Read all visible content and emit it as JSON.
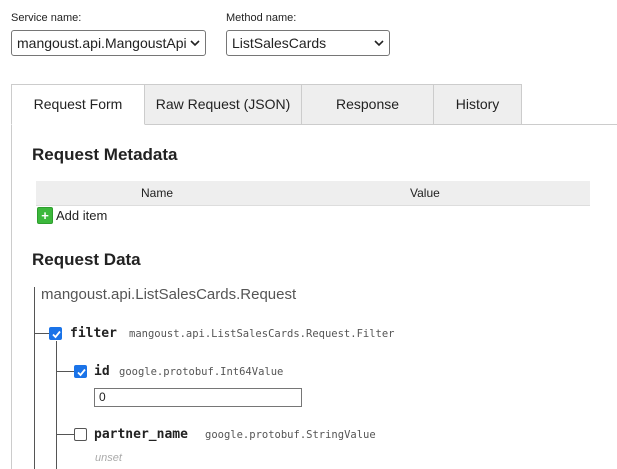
{
  "service": {
    "label": "Service name:",
    "value": "mangoust.api.MangoustApi"
  },
  "method": {
    "label": "Method name:",
    "value": "ListSalesCards"
  },
  "tabs": [
    {
      "label": "Request Form",
      "active": true
    },
    {
      "label": "Raw Request (JSON)",
      "active": false
    },
    {
      "label": "Response",
      "active": false
    },
    {
      "label": "History",
      "active": false
    }
  ],
  "metadata": {
    "heading": "Request Metadata",
    "columns": [
      "Name",
      "Value"
    ],
    "add_item": "Add item"
  },
  "request_data": {
    "heading": "Request Data",
    "message_type": "mangoust.api.ListSalesCards.Request",
    "fields": [
      {
        "name": "filter",
        "type": "mangoust.api.ListSalesCards.Request.Filter",
        "checked": true
      },
      {
        "name": "id",
        "type": "google.protobuf.Int64Value",
        "checked": true,
        "value": "0"
      },
      {
        "name": "partner_name",
        "type": "google.protobuf.StringValue",
        "checked": false,
        "unset_text": "unset"
      }
    ]
  },
  "colors": {
    "accent": "#1a73e8",
    "add_button": "#3cb83c",
    "tab_inactive_bg": "#eeeeee",
    "border": "#cccccc"
  }
}
